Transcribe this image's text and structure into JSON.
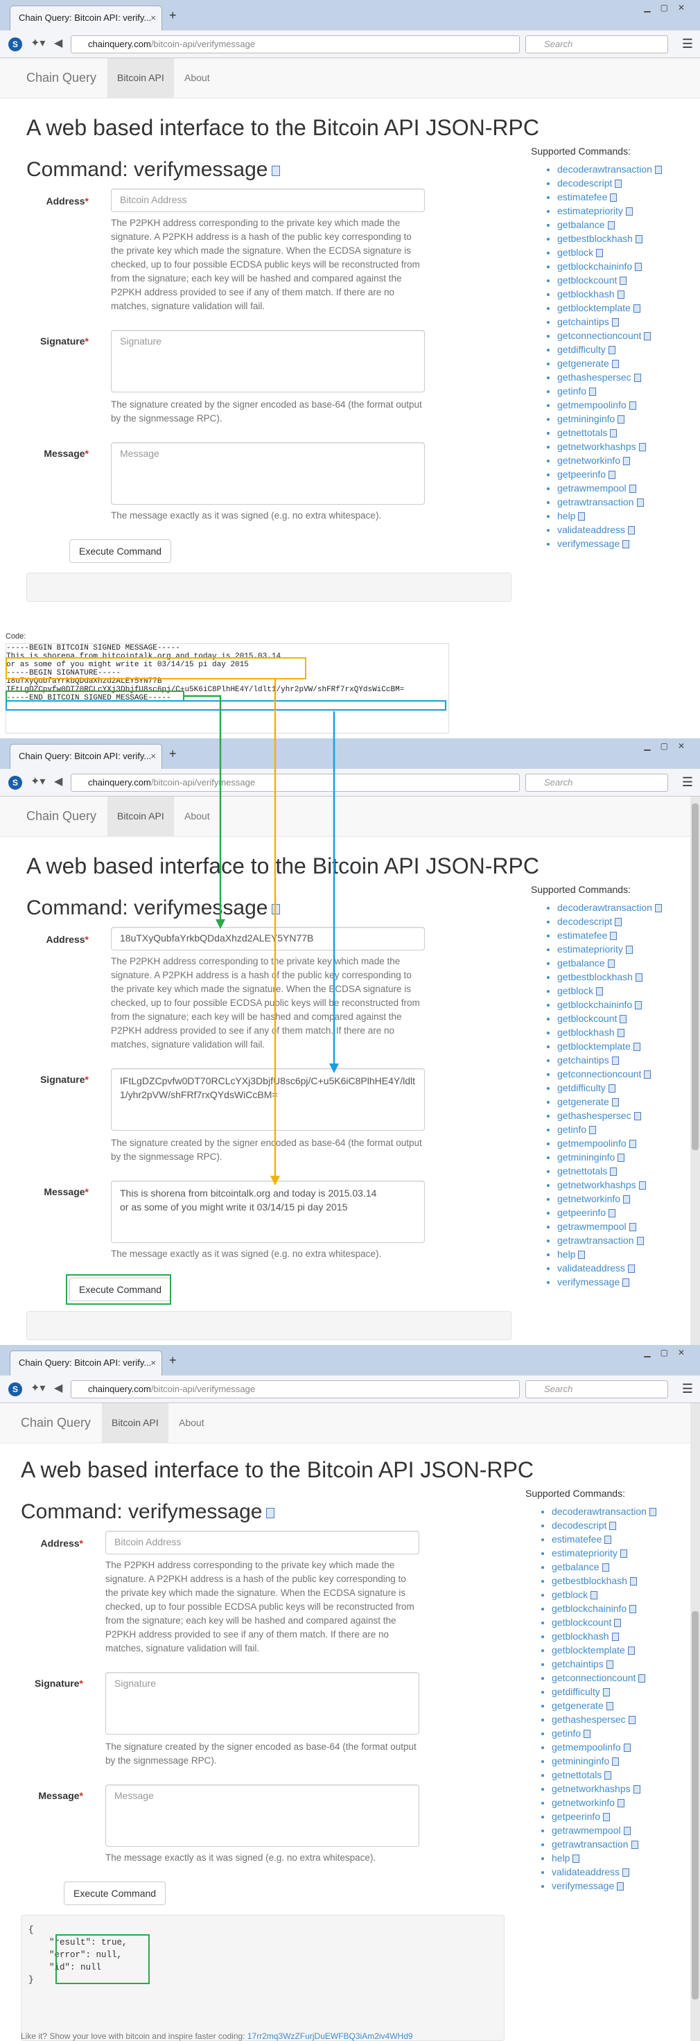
{
  "browser": {
    "tab_title": "Chain Query: Bitcoin API: verify...",
    "tab_close": "×",
    "new_tab": "+",
    "url_domain": "chainquery.com",
    "url_path": "/bitcoin-api/verifymessage",
    "search_placeholder": "Search"
  },
  "site": {
    "brand": "Chain Query",
    "nav": [
      "Bitcoin API",
      "About"
    ]
  },
  "page": {
    "heading": "A web based interface to the Bitcoin API JSON-RPC",
    "command_title": "Command: verifymessage",
    "address_label": "Address",
    "address_placeholder": "Bitcoin Address",
    "address_help": "The P2PKH address corresponding to the private key which made the signature. A P2PKH address is a hash of the public key corresponding to the private key which made the signature. When the ECDSA signature is checked, up to four possible ECDSA public keys will be reconstructed from from the signature; each key will be hashed and compared against the P2PKH address provided to see if any of them match. If there are no matches, signature validation will fail.",
    "signature_label": "Signature",
    "signature_placeholder": "Signature",
    "signature_help": "The signature created by the signer encoded as base-64 (the format output by the signmessage RPC).",
    "message_label": "Message",
    "message_placeholder": "Message",
    "message_help": "The message exactly as it was signed (e.g. no extra whitespace).",
    "execute_button": "Execute Command",
    "required_mark": "*"
  },
  "filled": {
    "address_value": "18uTXyQubfaYrkbQDdaXhzd2ALEY5YN77B",
    "signature_value": "IFtLgDZCpvfw0DT70RCLcYXj3DbjfU8sc6pj/C+u5K6iC8PlhHE4Y/ldlt1/yhr2pVW/shFRf7rxQYdsWiCcBM=",
    "message_line1": "This is shorena from bitcointalk.org and today is 2015.03.14",
    "message_line2": "or as some of you might write it 03/14/15 pi day 2015"
  },
  "result": {
    "json": "{\n    \"result\": true,\n    \"error\": null,\n    \"id\": null\n}"
  },
  "code_section": {
    "label": "Code:",
    "text": "-----BEGIN BITCOIN SIGNED MESSAGE-----\nThis is shorena from bitcointalk.org and today is 2015.03.14\nor as some of you might write it 03/14/15 pi day 2015\n-----BEGIN SIGNATURE-----\n18uTXyQubfaYrkbQDdaXhzd2ALEY5YN77B\nIFtLgDZCpvfw0DT70RCLcYXj3DbjfU8sc6pj/C+u5K6iC8PlhHE4Y/ldlt1/yhr2pVW/shFRf7rxQYdsWiCcBM=\n-----END BITCOIN SIGNED MESSAGE-----"
  },
  "sidebar": {
    "title": "Supported Commands:",
    "commands": [
      "decoderawtransaction",
      "decodescript",
      "estimatefee",
      "estimatepriority",
      "getbalance",
      "getbestblockhash",
      "getblock",
      "getblockchaininfo",
      "getblockcount",
      "getblockhash",
      "getblocktemplate",
      "getchaintips",
      "getconnectioncount",
      "getdifficulty",
      "getgenerate",
      "gethashespersec",
      "getinfo",
      "getmempoolinfo",
      "getmininginfo",
      "getnettotals",
      "getnetworkhashps",
      "getnetworkinfo",
      "getpeerinfo",
      "getrawmempool",
      "getrawtransaction",
      "help",
      "validateaddress",
      "verifymessage"
    ]
  },
  "footer": {
    "text": "Like it? Show your love with bitcoin and inspire faster coding:",
    "address": "17rr2mq3WzZFurjDuEWFBQ3iAm2iv4WHd9"
  },
  "colors": {
    "highlight_yellow": "#f0b400",
    "highlight_green": "#2aa84a",
    "highlight_blue": "#1a9ee0"
  }
}
